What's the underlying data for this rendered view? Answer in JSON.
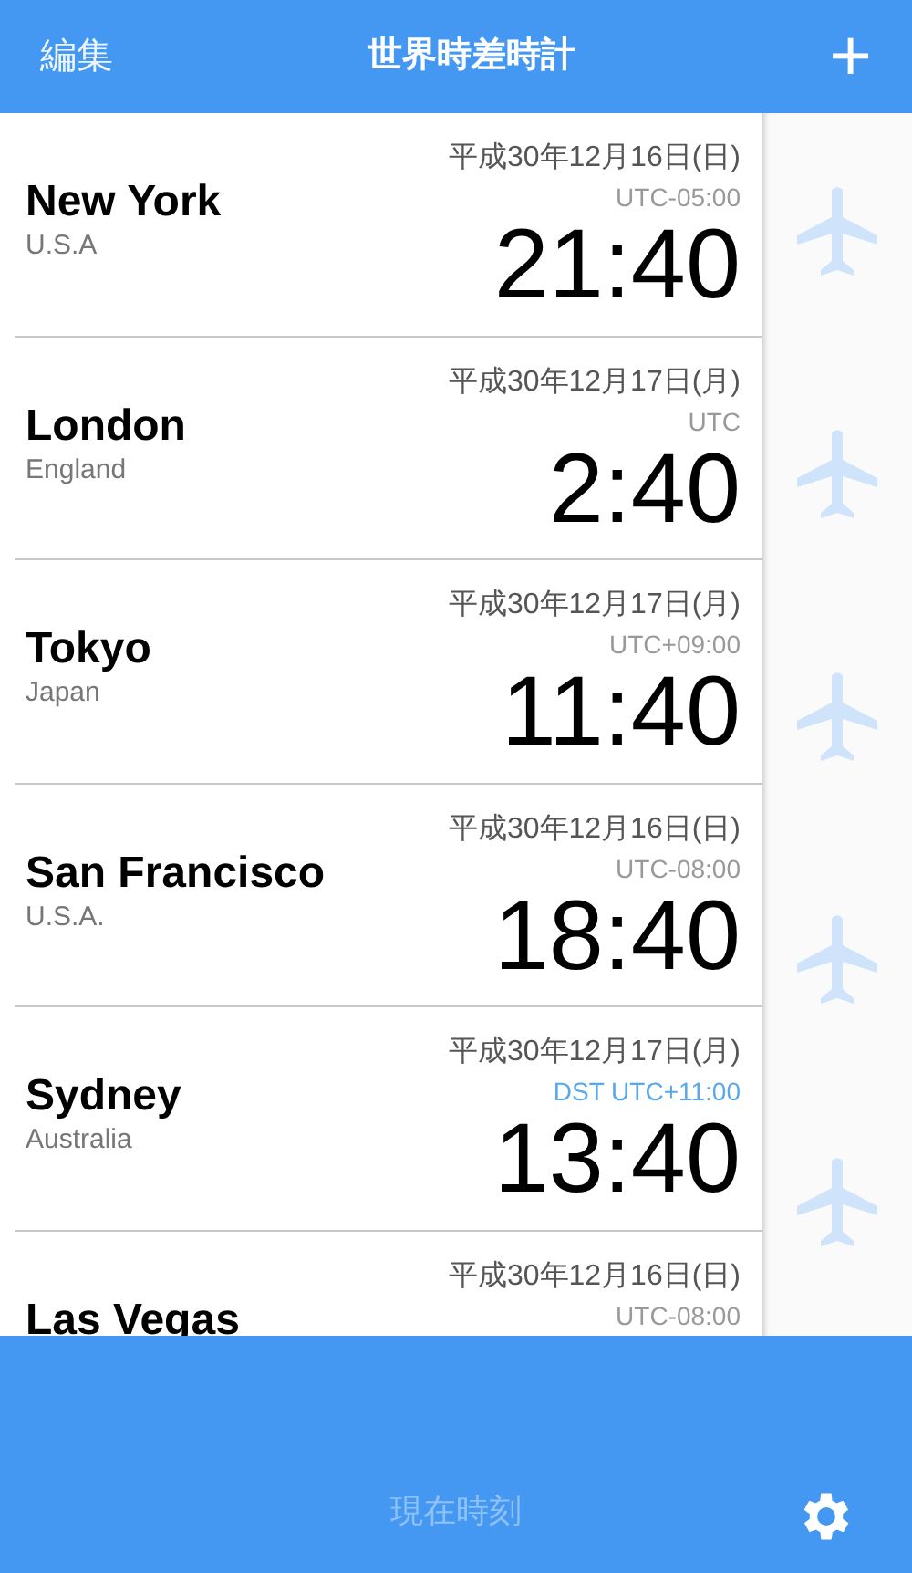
{
  "header": {
    "edit_button": "編集",
    "title": "世界時差時計",
    "add_button": "+"
  },
  "cities": [
    {
      "name": "New York",
      "country": "U.S.A",
      "date": "平成30年12月16日(日)",
      "utc": "UTC-05:00",
      "dst": false,
      "time": "21:40"
    },
    {
      "name": "London",
      "country": "England",
      "date": "平成30年12月17日(月)",
      "utc": "UTC",
      "dst": false,
      "time": "2:40"
    },
    {
      "name": "Tokyo",
      "country": "Japan",
      "date": "平成30年12月17日(月)",
      "utc": "UTC+09:00",
      "dst": false,
      "time": "11:40"
    },
    {
      "name": "San Francisco",
      "country": "U.S.A.",
      "date": "平成30年12月16日(日)",
      "utc": "UTC-08:00",
      "dst": false,
      "time": "18:40"
    },
    {
      "name": "Sydney",
      "country": "Australia",
      "date": "平成30年12月17日(月)",
      "utc": "DST UTC+11:00",
      "dst": true,
      "time": "13:40"
    },
    {
      "name": "Las Vegas",
      "date": "平成30年12月16日(日)",
      "utc": "UTC-08:00",
      "dst": false
    }
  ],
  "bottom_bar": {
    "now_button": {
      "label": "現在時刻",
      "disabled": true
    }
  }
}
